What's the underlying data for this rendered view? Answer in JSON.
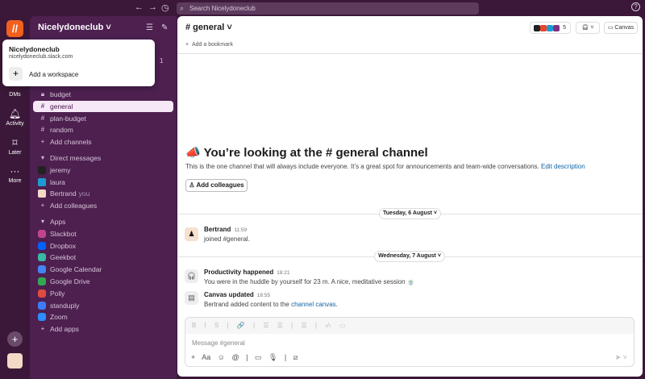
{
  "topbar": {
    "search_placeholder": "Search Nicelydoneclub",
    "back": "←",
    "forward": "→",
    "history": "◷",
    "help": "?"
  },
  "rail": {
    "logo": "//",
    "items": [
      {
        "label": "DMs"
      },
      {
        "label": "Activity",
        "icon": "🔔"
      },
      {
        "label": "Later",
        "icon": "🔖"
      },
      {
        "label": "More",
        "icon": "···"
      }
    ],
    "add": "+"
  },
  "workspace": {
    "name": "Nicelydoneclub ˅",
    "threads_badge": "1"
  },
  "popup": {
    "name": "Nicelydoneclub",
    "url": "nicelydoneclub.slack.com",
    "add_label": "Add a workspace"
  },
  "channels": [
    {
      "name": "budget",
      "icon": "lock"
    },
    {
      "name": "general",
      "selected": true
    },
    {
      "name": "plan-budget"
    },
    {
      "name": "random"
    }
  ],
  "add_channels": "Add channels",
  "dm_section": "Direct messages",
  "dms": [
    {
      "name": "jeremy"
    },
    {
      "name": "laura"
    },
    {
      "name": "Bertrand",
      "suffix": "you"
    }
  ],
  "add_colleagues": "Add colleagues",
  "apps_section": "Apps",
  "apps": [
    {
      "name": "Slackbot",
      "color": "#c0448f"
    },
    {
      "name": "Dropbox",
      "color": "#0061fe"
    },
    {
      "name": "Geekbot",
      "color": "#3ab9a3"
    },
    {
      "name": "Google Calendar",
      "color": "#4285f4"
    },
    {
      "name": "Google Drive",
      "color": "#34a853"
    },
    {
      "name": "Polly",
      "color": "#e04a3f"
    },
    {
      "name": "standuply",
      "color": "#3d7bf7"
    },
    {
      "name": "Zoom",
      "color": "#2d8cff"
    }
  ],
  "add_apps": "Add apps",
  "header": {
    "channel": "# general ˅",
    "member_count": "5",
    "canvas": "Canvas",
    "bookmark": "Add a bookmark"
  },
  "intro": {
    "heading": "You’re looking at the # general channel",
    "desc": "This is the one channel that will always include everyone. It’s a great spot for announcements and team-wide conversations.",
    "edit": "Edit description",
    "button": "Add colleagues"
  },
  "dates": [
    "Tuesday, 6 August ˅",
    "Wednesday, 7 August ˅"
  ],
  "messages": [
    {
      "author": "Bertrand",
      "time": "11:59",
      "text": "joined #general."
    },
    {
      "author": "Productivity happened",
      "time": "18:21",
      "text": "You were in the huddle by yourself for 23 m. A nice, meditative session 🍵"
    },
    {
      "author": "Canvas updated",
      "time": "18:55",
      "text": "Bertrand added content to the ",
      "link": "channel canvas",
      "tail": "."
    }
  ],
  "composer": {
    "placeholder": "Message #general",
    "format": "B I S | 🔗 | ☰ ☰ | ☰ | ‹/› ▭",
    "tools": "+ Aa ☺ @ | ▭ 🎙 | ⧄",
    "send": "➤ ˅"
  }
}
